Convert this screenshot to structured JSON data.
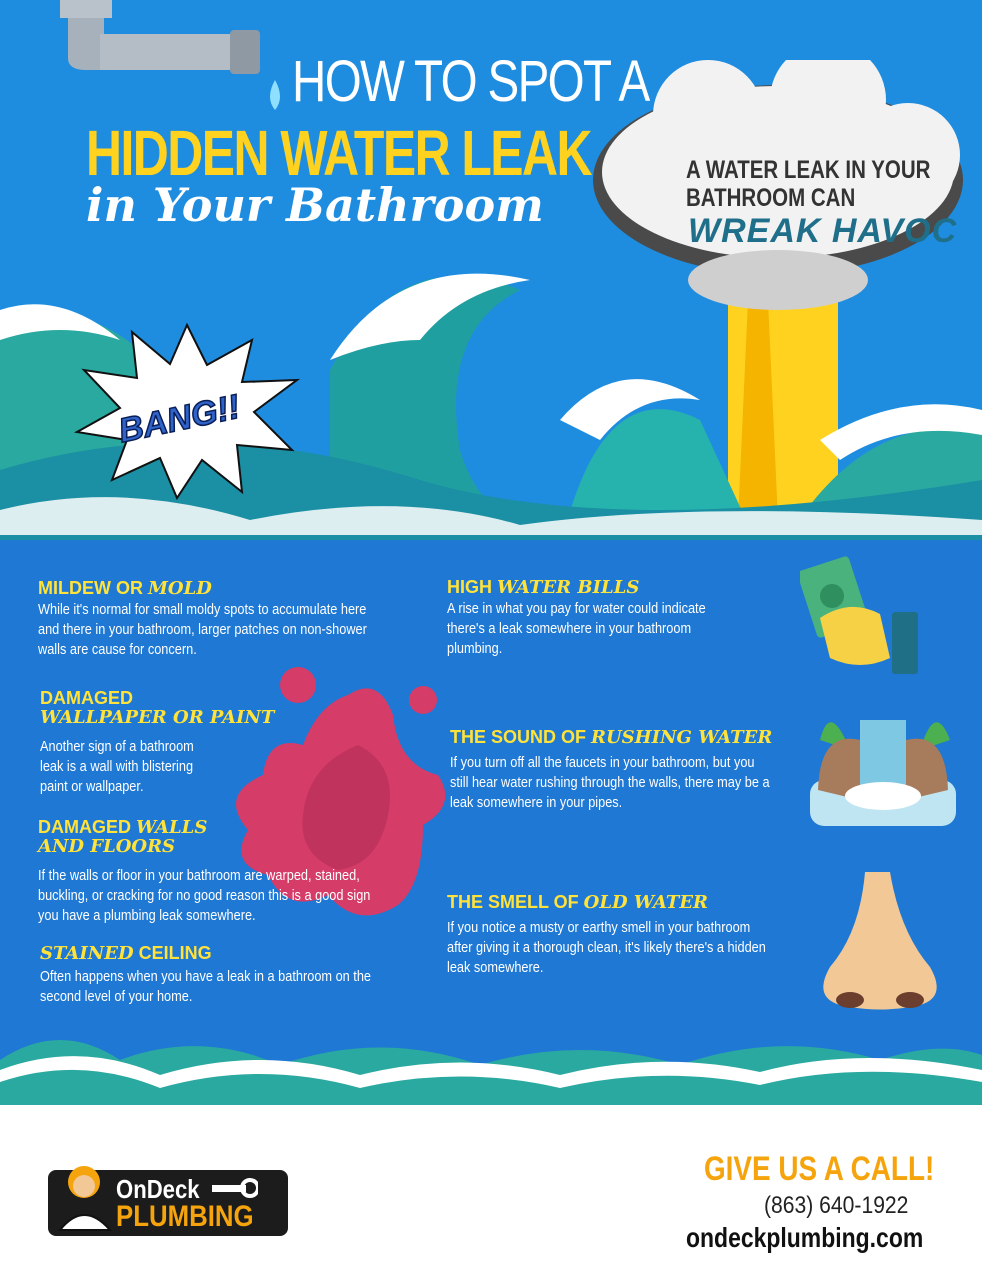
{
  "header": {
    "line1": "HOW TO SPOT A",
    "line2": "HIDDEN WATER LEAK",
    "line3": "in Your Bathroom"
  },
  "cloud": {
    "line1": "A WATER LEAK IN YOUR",
    "line2": "BATHROOM CAN",
    "emphasis": "WREAK HAVOC"
  },
  "bang": "BANG!!",
  "signs_left": [
    {
      "title_plain": "MILDEW OR ",
      "title_script": "MOLD",
      "body": "While it's normal for small moldy spots to accumulate here and there in your bathroom, larger patches on non-shower walls are cause for concern."
    },
    {
      "title_plain": "DAMAGED",
      "title_script": "WALLPAPER OR PAINT",
      "body": "Another sign of a bathroom leak is a wall with blistering paint or wallpaper."
    },
    {
      "title_plain": "DAMAGED ",
      "title_script": "WALLS AND FLOORS",
      "body": "If the walls or floor in your bathroom are warped, stained, buckling, or cracking for no good reason this is a good sign you have a plumbing leak somewhere."
    },
    {
      "title_script": "STAINED",
      "title_plain": " CEILING",
      "body": "Often happens when you have a leak in a bathroom on the second level of your home."
    }
  ],
  "signs_right": [
    {
      "title_plain": "HIGH ",
      "title_script": "WATER BILLS",
      "body": "A rise in what you pay for water could indicate there's a leak somewhere in your bathroom plumbing."
    },
    {
      "title_plain": "THE SOUND OF ",
      "title_script": "RUSHING WATER",
      "body": "If you turn off all the faucets in your bathroom, but you still hear water rushing through the walls, there may be a leak somewhere in your pipes."
    },
    {
      "title_plain": "THE SMELL OF ",
      "title_script": "OLD WATER",
      "body": "If you notice a musty or earthy smell in your bathroom after giving it a thorough clean, it's likely there's a hidden leak somewhere."
    }
  ],
  "footer": {
    "cta": "GIVE US A CALL!",
    "phone": "(863) 640-1922",
    "website": "ondeckplumbing.com",
    "logo_top": "OnDeck",
    "logo_bottom": "PLUMBING"
  },
  "colors": {
    "sky": "#1e8de0",
    "sea": "#1f78d4",
    "accent_yellow": "#ffd21f",
    "cta_orange": "#f5a40d",
    "splat": "#d53c68"
  },
  "icons": [
    "pipe-icon",
    "money-hand-icon",
    "waterfall-icon",
    "nose-icon",
    "plumber-mascot-icon",
    "wrench-icon",
    "explosion-burst-icon",
    "paint-splat-icon",
    "mushroom-cloud-icon"
  ]
}
